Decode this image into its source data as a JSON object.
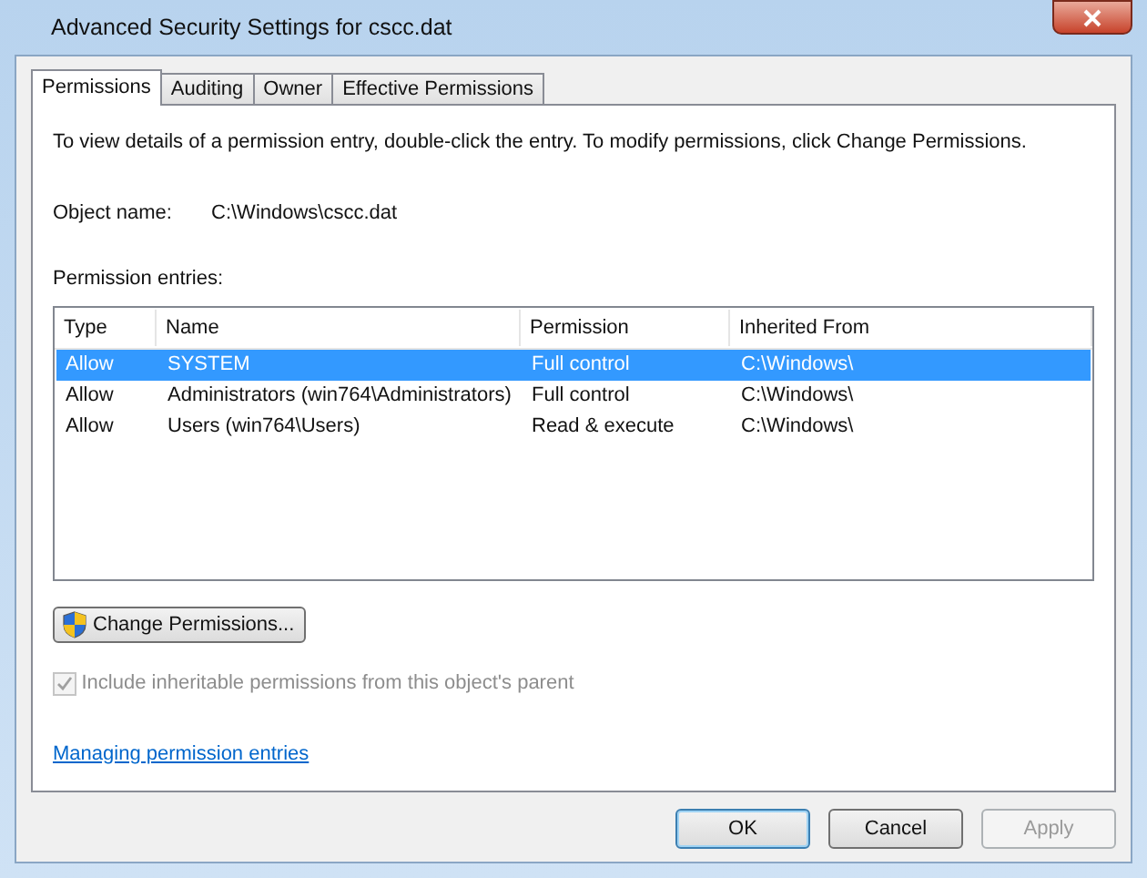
{
  "window": {
    "title": "Advanced Security Settings for cscc.dat"
  },
  "tabs": [
    {
      "label": "Permissions",
      "selected": true
    },
    {
      "label": "Auditing",
      "selected": false
    },
    {
      "label": "Owner",
      "selected": false
    },
    {
      "label": "Effective Permissions",
      "selected": false
    }
  ],
  "instructions": "To view details of a permission entry, double-click the entry. To modify permissions, click Change Permissions.",
  "object_name": {
    "label": "Object name:",
    "value": "C:\\Windows\\cscc.dat"
  },
  "entries_label": "Permission entries:",
  "table": {
    "columns": [
      "Type",
      "Name",
      "Permission",
      "Inherited From"
    ],
    "rows": [
      {
        "cells": [
          "Allow",
          "SYSTEM",
          "Full control",
          "C:\\Windows\\"
        ],
        "selected": true
      },
      {
        "cells": [
          "Allow",
          "Administrators (win764\\Administrators)",
          "Full control",
          "C:\\Windows\\"
        ],
        "selected": false
      },
      {
        "cells": [
          "Allow",
          "Users (win764\\Users)",
          "Read & execute",
          "C:\\Windows\\"
        ],
        "selected": false
      }
    ]
  },
  "change_button": "Change Permissions...",
  "inherit_checkbox": {
    "label": "Include inheritable permissions from this object's parent",
    "checked": true,
    "disabled": true
  },
  "help_link": "Managing permission entries",
  "buttons": [
    {
      "label": "OK",
      "default": true,
      "disabled": false
    },
    {
      "label": "Cancel",
      "default": false,
      "disabled": false
    },
    {
      "label": "Apply",
      "default": false,
      "disabled": true
    }
  ]
}
